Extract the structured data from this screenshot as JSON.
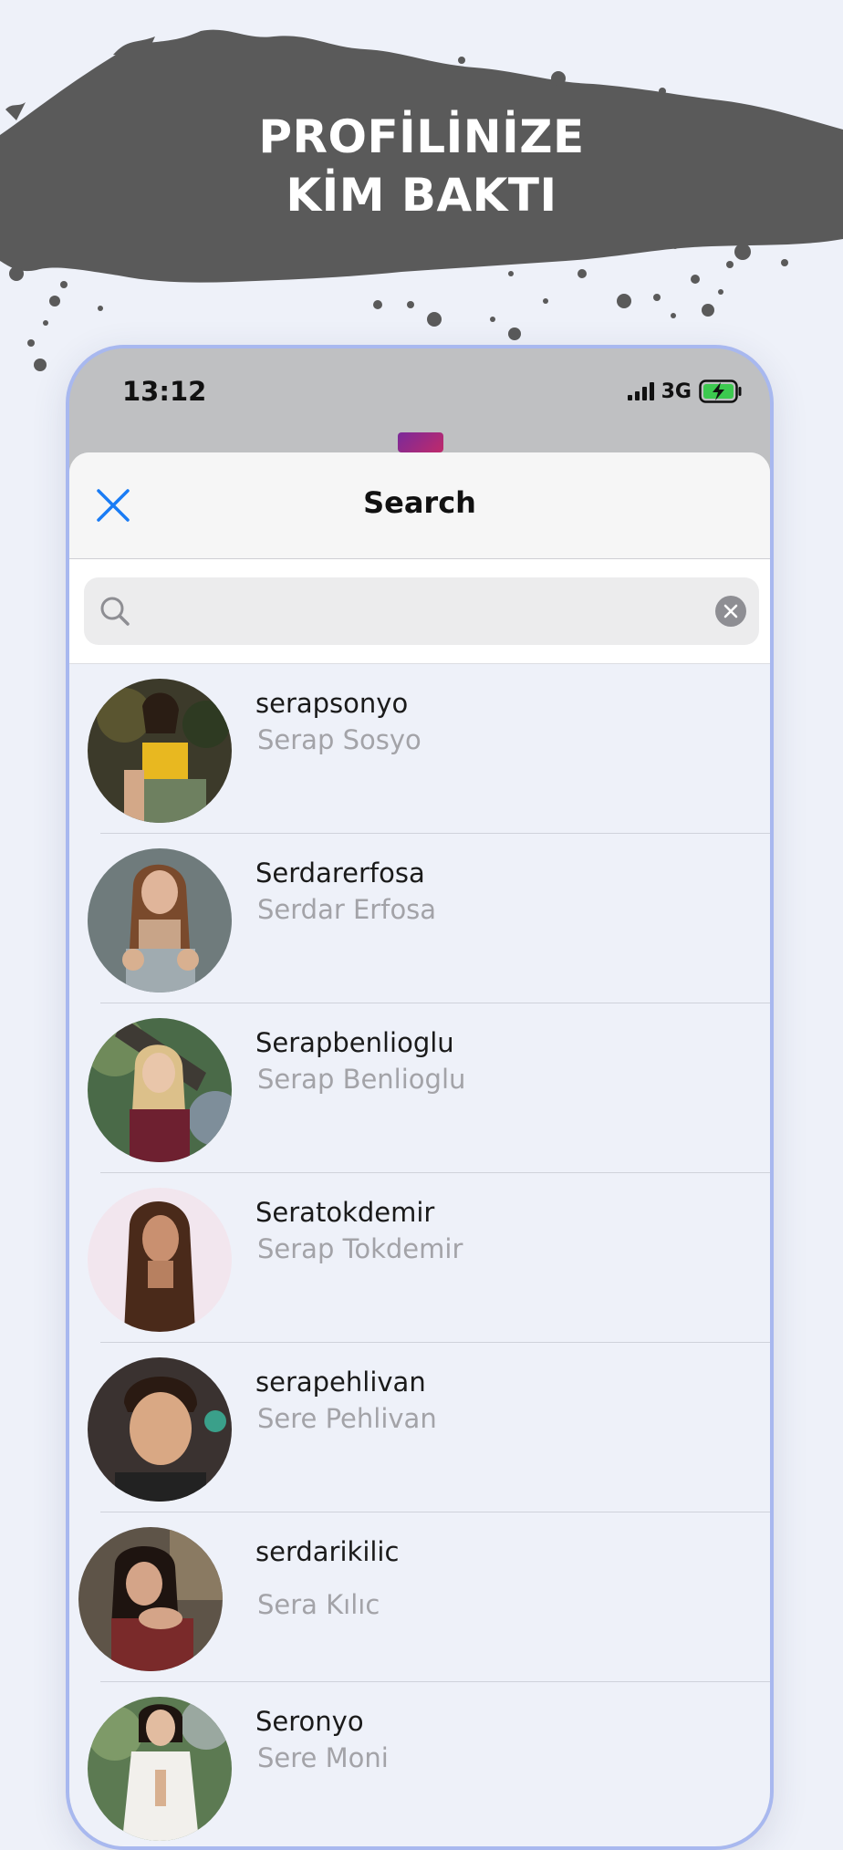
{
  "banner": {
    "line1": "PROFİLİNİZE",
    "line2": "KİM BAKTI"
  },
  "status_bar": {
    "time": "13:12",
    "network": "3G"
  },
  "search_sheet": {
    "title": "Search",
    "search_value": "",
    "search_placeholder": ""
  },
  "results": [
    {
      "username": "serapsonyo",
      "full_name": "Serap Sosyo"
    },
    {
      "username": "Serdarerfosa",
      "full_name": "Serdar Erfosa"
    },
    {
      "username": "Serapbenlioglu",
      "full_name": "Serap Benlioglu"
    },
    {
      "username": "Seratokdemir",
      "full_name": "Serap Tokdemir"
    },
    {
      "username": "serapehlivan",
      "full_name": "Sere Pehlivan"
    },
    {
      "username": "serdarikilic",
      "full_name": "Sera Kılıc"
    },
    {
      "username": "Seronyo",
      "full_name": "Sere Moni"
    }
  ],
  "colors": {
    "accent": "#1a7cf5",
    "background": "#eef1f9",
    "banner_brush": "#5a5a5a",
    "phone_border": "#a8b8ef",
    "secondary_text": "#a3a3a8"
  },
  "icons": {
    "close": "close-icon",
    "search": "search-icon",
    "clear": "clear-icon",
    "signal": "signal-icon",
    "battery": "battery-charging-icon"
  }
}
